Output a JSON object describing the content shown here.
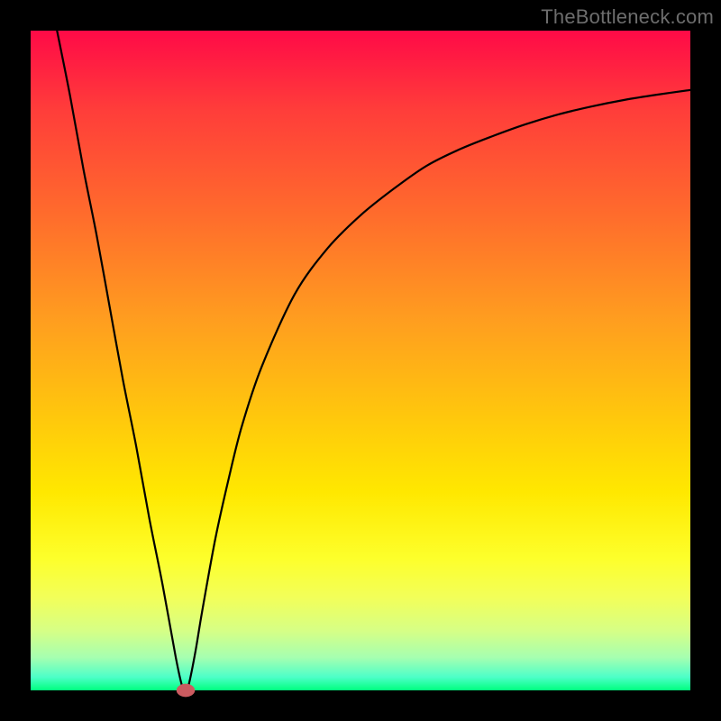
{
  "watermark": "TheBottleneck.com",
  "colors": {
    "frame": "#000000",
    "curve": "#000000",
    "marker": "#cb5b60",
    "gradient_top": "#ff0a47",
    "gradient_bottom": "#00ff7f"
  },
  "chart_data": {
    "type": "line",
    "title": "",
    "xlabel": "",
    "ylabel": "",
    "xlim": [
      0,
      100
    ],
    "ylim": [
      0,
      100
    ],
    "x": [
      4,
      6,
      8,
      10,
      12,
      14,
      16,
      18,
      20,
      22,
      23,
      23.5,
      24,
      25,
      26,
      28,
      30,
      32,
      35,
      40,
      45,
      50,
      55,
      60,
      65,
      70,
      75,
      80,
      85,
      90,
      95,
      100
    ],
    "values": [
      100,
      90,
      79,
      69,
      58,
      47,
      37,
      26,
      16,
      5,
      0.5,
      0,
      1,
      6,
      12,
      23,
      32,
      40,
      49,
      60,
      67,
      72,
      76,
      79.5,
      82,
      84,
      85.8,
      87.3,
      88.5,
      89.5,
      90.3,
      91
    ],
    "marker": {
      "x": 23.5,
      "y": 0,
      "rx": 1.4,
      "ry": 1.0
    },
    "notes": "V-shaped curve over a red→green vertical gradient; minimum touches y=0 around x≈23.5"
  }
}
